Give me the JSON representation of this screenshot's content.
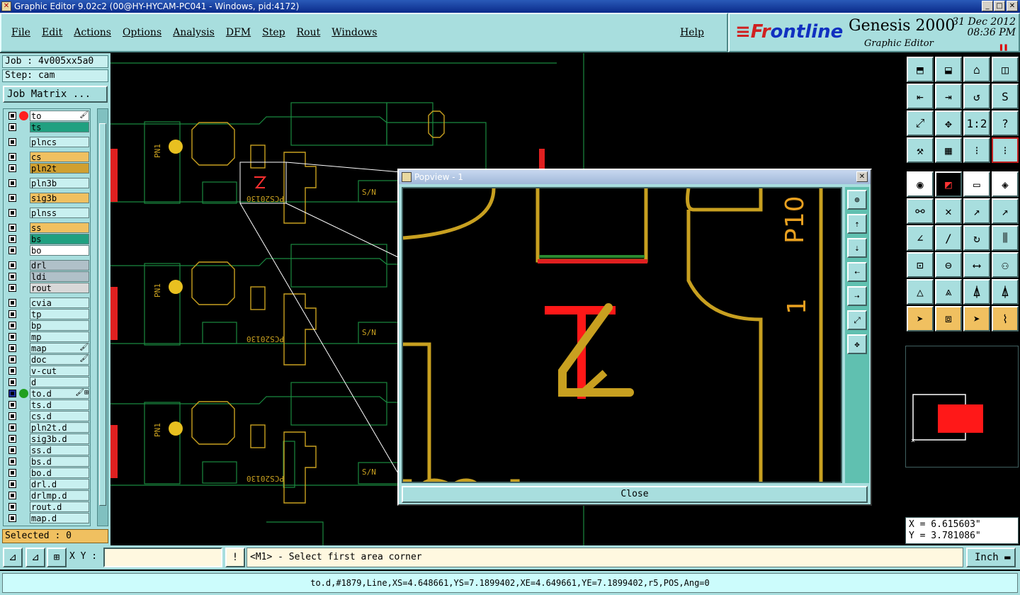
{
  "window": {
    "title": "Graphic Editor 9.02c2 (00@HY-HYCAM-PC041 - Windows, pid:4172)",
    "min_label": "_",
    "max_label": "□",
    "close_label": "✕"
  },
  "menu": {
    "items": [
      "File",
      "Edit",
      "Actions",
      "Options",
      "Analysis",
      "DFM",
      "Step",
      "Rout",
      "Windows"
    ],
    "help": "Help"
  },
  "brand": {
    "logo_left": "≡Fr",
    "logo_right": "ontline",
    "product": "Genesis 2000",
    "subtitle": "Graphic Editor",
    "date": "31 Dec 2012",
    "time": "08:36 PM",
    "pause": "❚❚"
  },
  "job": {
    "job_label": "Job : 4v005xx5a0",
    "step_label": "Step: cam",
    "matrix_button": "Job Matrix ..."
  },
  "layers": [
    {
      "name": "to",
      "dot": "#ff2020",
      "sel": true,
      "flag": "🖌",
      "bg": "#ffffff"
    },
    {
      "name": "ts",
      "dot": "",
      "bg": "#20a080"
    },
    {
      "name": "plncs",
      "dot": "",
      "bg": "#c8f0f0"
    },
    {
      "name": "cs",
      "dot": "",
      "bg": "#f0c060"
    },
    {
      "name": "pln2t",
      "dot": "",
      "bg": "#d0a030"
    },
    {
      "name": "pln3b",
      "dot": "",
      "bg": "#c8f0f0"
    },
    {
      "name": "sig3b",
      "dot": "",
      "bg": "#f0c060"
    },
    {
      "name": "plnss",
      "dot": "",
      "bg": "#c8f0f0"
    },
    {
      "name": "ss",
      "dot": "",
      "bg": "#f0c060"
    },
    {
      "name": "bs",
      "dot": "",
      "bg": "#20a080"
    },
    {
      "name": "bo",
      "dot": "",
      "bg": "#ffffff"
    },
    {
      "name": "drl",
      "dot": "",
      "bg": "#b0c0c8"
    },
    {
      "name": "ldi",
      "dot": "",
      "bg": "#b0c0c8"
    },
    {
      "name": "rout",
      "dot": "",
      "bg": "#d8d8d8"
    },
    {
      "name": "cvia",
      "dot": "",
      "bg": "#c8f0f0"
    },
    {
      "name": "tp",
      "dot": "",
      "bg": "#c8f0f0"
    },
    {
      "name": "bp",
      "dot": "",
      "bg": "#c8f0f0"
    },
    {
      "name": "mp",
      "dot": "",
      "bg": "#c8f0f0"
    },
    {
      "name": "map",
      "dot": "",
      "flag": "🖌",
      "bg": "#c8f0f0"
    },
    {
      "name": "doc",
      "dot": "",
      "flag": "🖌",
      "bg": "#c8f0f0"
    },
    {
      "name": "v-cut",
      "dot": "",
      "bg": "#c8f0f0"
    },
    {
      "name": "d",
      "dot": "",
      "bg": "#c8f0f0"
    },
    {
      "name": "to.d",
      "dot": "#20a020",
      "flag": "🖌⊞",
      "bg": "#c8f0f0",
      "blue": true
    },
    {
      "name": "ts.d",
      "dot": "",
      "bg": "#c8f0f0"
    },
    {
      "name": "cs.d",
      "dot": "",
      "bg": "#c8f0f0"
    },
    {
      "name": "pln2t.d",
      "dot": "",
      "bg": "#c8f0f0"
    },
    {
      "name": "sig3b.d",
      "dot": "",
      "bg": "#c8f0f0"
    },
    {
      "name": "ss.d",
      "dot": "",
      "bg": "#c8f0f0"
    },
    {
      "name": "bs.d",
      "dot": "",
      "bg": "#c8f0f0"
    },
    {
      "name": "bo.d",
      "dot": "",
      "bg": "#c8f0f0"
    },
    {
      "name": "drl.d",
      "dot": "",
      "bg": "#c8f0f0"
    },
    {
      "name": "drlmp.d",
      "dot": "",
      "bg": "#c8f0f0"
    },
    {
      "name": "rout.d",
      "dot": "",
      "bg": "#c8f0f0"
    },
    {
      "name": "map.d",
      "dot": "",
      "bg": "#c8f0f0"
    }
  ],
  "selected": "Selected : 0",
  "popview": {
    "title": "Popview - 1",
    "close_button": "Close",
    "board_text": "PCS20130",
    "side_text": "P10",
    "side_num": "1"
  },
  "canvas": {
    "pcs_labels": [
      "PCS20130",
      "PCS20130",
      "PCS20130"
    ],
    "sn_label": "S/N",
    "pn_label": "PN1"
  },
  "coords": {
    "x": "X = 6.615603\"",
    "y": "Y = 3.781086\""
  },
  "bottom": {
    "xy_label": "X Y :",
    "xy_value": "",
    "prompt": "<M1> - Select first area corner",
    "unit": "Inch"
  },
  "status": "to.d,#1879,Line,XS=4.648661,YS=7.1899402,XE=4.649661,YE=7.1899402,r5,POS,Ang=0",
  "colors": {
    "accent": "#a8dede",
    "copper": "#c8a020",
    "highlight": "#ff2020",
    "selected_bg": "#f0c060"
  }
}
